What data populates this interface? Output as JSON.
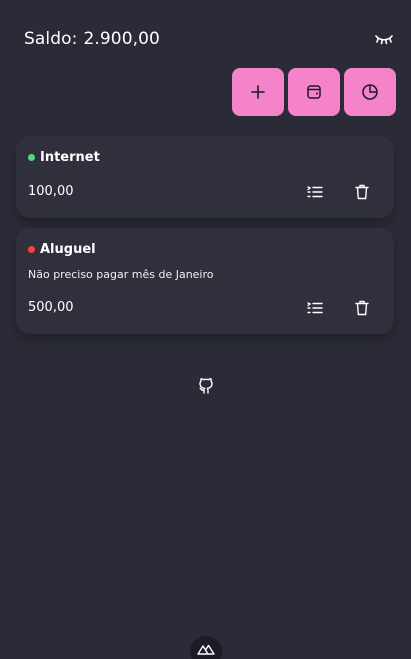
{
  "header": {
    "balance_label": "Saldo:",
    "balance_value": "2.900,00",
    "visibility_icon": "eye-closed-icon"
  },
  "actions": [
    {
      "icon": "plus-icon"
    },
    {
      "icon": "wallet-icon"
    },
    {
      "icon": "pie-chart-icon"
    }
  ],
  "bills": [
    {
      "title": "Internet",
      "status_color": "#4ade80",
      "description": "",
      "value": "100,00"
    },
    {
      "title": "Aluguel",
      "status_color": "#ef4444",
      "description": "Não preciso pagar mês de Janeiro",
      "value": "500,00"
    }
  ],
  "footer": {
    "icon": "github-icon"
  },
  "badge": {
    "icon": "nuxt-logo-icon"
  },
  "colors": {
    "background": "#2a2b36",
    "card": "#2f303c",
    "accent": "#f483c9"
  }
}
